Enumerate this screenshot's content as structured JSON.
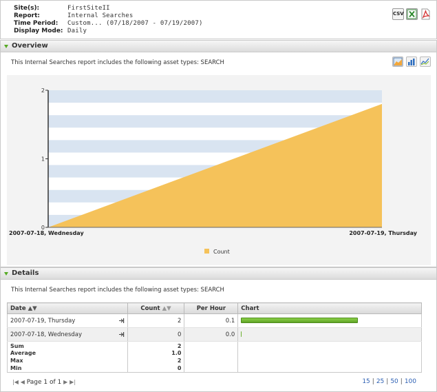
{
  "header": {
    "site_label": "Site(s):",
    "site_value": "FirstSiteII",
    "report_label": "Report:",
    "report_value": "Internal Searches",
    "period_label": "Time Period:",
    "period_value": "Custom... (07/18/2007 - 07/19/2007)",
    "mode_label": "Display Mode:",
    "mode_value": "Daily",
    "export_csv_label": "CSV",
    "export_icons": [
      "csv-icon",
      "excel-icon",
      "pdf-icon"
    ]
  },
  "overview": {
    "title": "Overview",
    "intro": "This Internal Searches report includes the following asset types: SEARCH",
    "chart_tools": [
      "area-chart-icon",
      "bar-chart-icon",
      "line-chart-icon"
    ]
  },
  "chart_data": {
    "type": "area",
    "title": "",
    "xlabel": "",
    "ylabel": "",
    "categories": [
      "2007-07-18, Wednesday",
      "2007-07-19, Thursday"
    ],
    "series": [
      {
        "name": "Count",
        "values": [
          0,
          1.8
        ],
        "color": "#f5c25a"
      }
    ],
    "ylim": [
      0,
      2
    ],
    "y_ticks": [
      "0",
      "1",
      "2"
    ],
    "grid": true,
    "legend": "bottom",
    "band_color": "#d9e4f1"
  },
  "details": {
    "title": "Details",
    "intro": "This Internal Searches report includes the following asset types: SEARCH",
    "columns": [
      "Date",
      "Count",
      "Per Hour",
      "Chart"
    ],
    "rows": [
      {
        "date": "2007-07-19, Thursday",
        "count": "2",
        "per_hour": "0.1",
        "bar": 1.0
      },
      {
        "date": "2007-07-18, Wednesday",
        "count": "0",
        "per_hour": "0.0",
        "bar": 0.0
      }
    ],
    "summary": [
      {
        "label": "Sum",
        "value": "2"
      },
      {
        "label": "Average",
        "value": "1.0"
      },
      {
        "label": "Max",
        "value": "2"
      },
      {
        "label": "Min",
        "value": "0"
      }
    ],
    "pager": {
      "text": "Page 1 of 1"
    },
    "page_sizes": [
      "15",
      "25",
      "50",
      "100"
    ],
    "bar_color": "#6cb02f"
  }
}
